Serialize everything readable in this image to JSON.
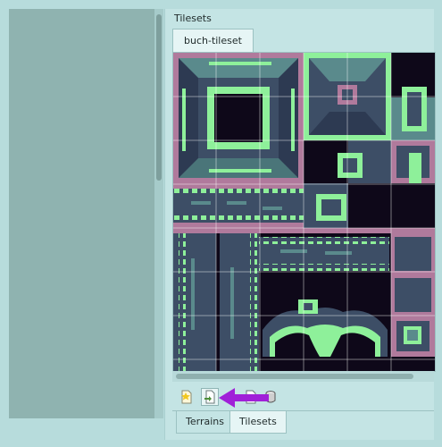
{
  "left_panel": {
    "background": "#8fb3b0"
  },
  "tilesets_panel": {
    "title": "Tilesets",
    "tabs": [
      {
        "label": "buch-tileset",
        "active": true
      }
    ],
    "toolbar": {
      "buttons": [
        {
          "name": "new-tileset-button",
          "icon": "new-document-star-icon",
          "pressed": false
        },
        {
          "name": "import-tileset-button",
          "icon": "import-document-icon",
          "pressed": true
        },
        {
          "name": "export-tileset-button",
          "icon": "export-document-icon",
          "pressed": false
        },
        {
          "name": "embed-tileset-button",
          "icon": "database-icon",
          "pressed": false
        }
      ]
    },
    "annotation": {
      "icon": "purple-arrow-left",
      "color": "#a020d8"
    }
  },
  "bottom_tabs": [
    {
      "label": "Terrains",
      "active": false
    },
    {
      "label": "Tilesets",
      "active": true
    }
  ],
  "colors": {
    "tile_dark": "#0e0819",
    "tile_slate": "#3d4e66",
    "tile_teal": "#5a8a8c",
    "tile_green": "#8ef09a",
    "tile_pink": "#b07a9c"
  }
}
